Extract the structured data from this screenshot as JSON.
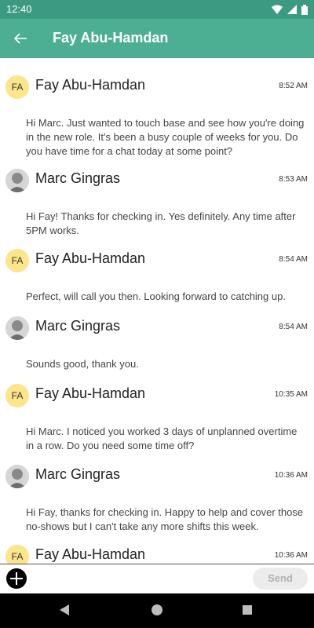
{
  "status_bar": {
    "time": "12:40"
  },
  "app_bar": {
    "title": "Fay Abu-Hamdan"
  },
  "messages": [
    {
      "sender": "Fay Abu-Hamdan",
      "initials": "FA",
      "time": "8:52 AM",
      "text": "Hi Marc. Just wanted to touch base and see how you're doing in the new role. It's been a busy couple of weeks for you. Do you have time for a chat today at some point?"
    },
    {
      "sender": "Marc Gingras",
      "initials": "",
      "time": "8:53 AM",
      "text": "Hi Fay! Thanks for checking in. Yes definitely. Any time after 5PM works."
    },
    {
      "sender": "Fay Abu-Hamdan",
      "initials": "FA",
      "time": "8:54 AM",
      "text": "Perfect, will call you then. Looking forward to catching up."
    },
    {
      "sender": "Marc Gingras",
      "initials": "",
      "time": "8:54 AM",
      "text": "Sounds good, thank you."
    },
    {
      "sender": "Fay Abu-Hamdan",
      "initials": "FA",
      "time": "10:35 AM",
      "text": "Hi Marc. I noticed you worked 3 days of unplanned overtime in a row. Do you need some time off?"
    },
    {
      "sender": "Marc Gingras",
      "initials": "",
      "time": "10:36 AM",
      "text": "Hi Fay, thanks for checking in. Happy to help and cover those no-shows but I can't take any more shifts this week."
    },
    {
      "sender": "Fay Abu-Hamdan",
      "initials": "FA",
      "time": "10:36 AM",
      "text": ""
    }
  ],
  "composer": {
    "send_label": "Send"
  },
  "colors": {
    "status_bar": "#3d9a82",
    "app_bar": "#4caf94",
    "initials_avatar": "#fde58c"
  }
}
